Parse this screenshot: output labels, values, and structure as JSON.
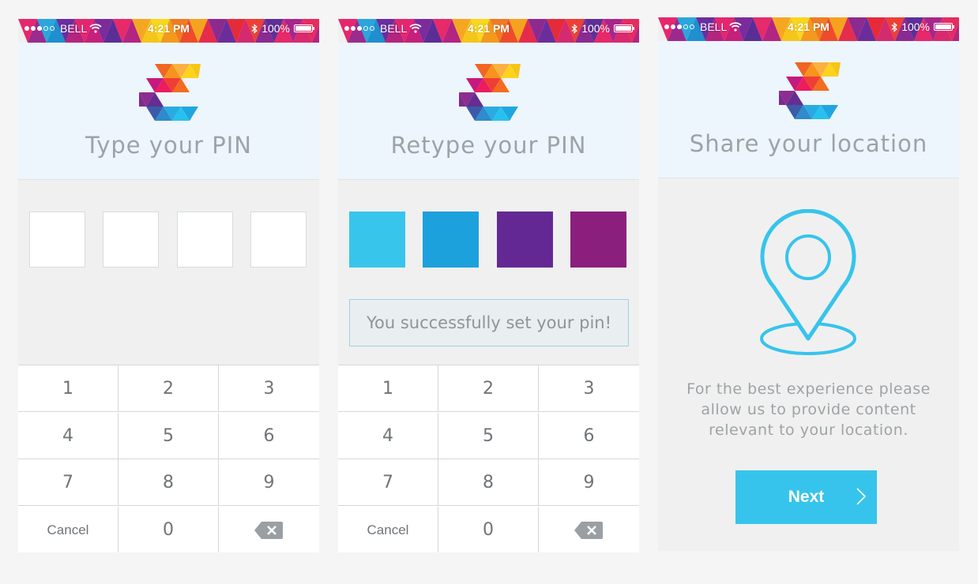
{
  "status_bar": {
    "carrier": "BELL",
    "time": "4:21 PM",
    "battery": "100%",
    "signal_dots_filled": 3,
    "signal_dots_total": 5
  },
  "screens": [
    {
      "title": "Type your PIN",
      "pin_boxes": [
        "#ffffff",
        "#ffffff",
        "#ffffff",
        "#ffffff"
      ],
      "keypad": {
        "k1": "1",
        "k2": "2",
        "k3": "3",
        "k4": "4",
        "k5": "5",
        "k6": "6",
        "k7": "7",
        "k8": "8",
        "k9": "9",
        "cancel": "Cancel",
        "k0": "0",
        "delete_icon": "backspace-icon"
      }
    },
    {
      "title": "Retype your PIN",
      "pin_boxes": [
        "#38c5ec",
        "#1da1dd",
        "#642894",
        "#8b1f7e"
      ],
      "success_message": "You successfully set your pin!",
      "keypad": {
        "k1": "1",
        "k2": "2",
        "k3": "3",
        "k4": "4",
        "k5": "5",
        "k6": "6",
        "k7": "7",
        "k8": "8",
        "k9": "9",
        "cancel": "Cancel",
        "k0": "0",
        "delete_icon": "backspace-icon"
      }
    },
    {
      "title": "Share your location",
      "icon": "location-pin-icon",
      "description_lines": [
        "For the best experience please",
        "allow us to provide content",
        "relevant to your location."
      ],
      "next_label": "Next"
    }
  ],
  "colors": {
    "header_bg": "#edf6fc",
    "accent": "#37c4ec",
    "keypad_text": "#6f7478",
    "title_text": "#9da3a6"
  }
}
